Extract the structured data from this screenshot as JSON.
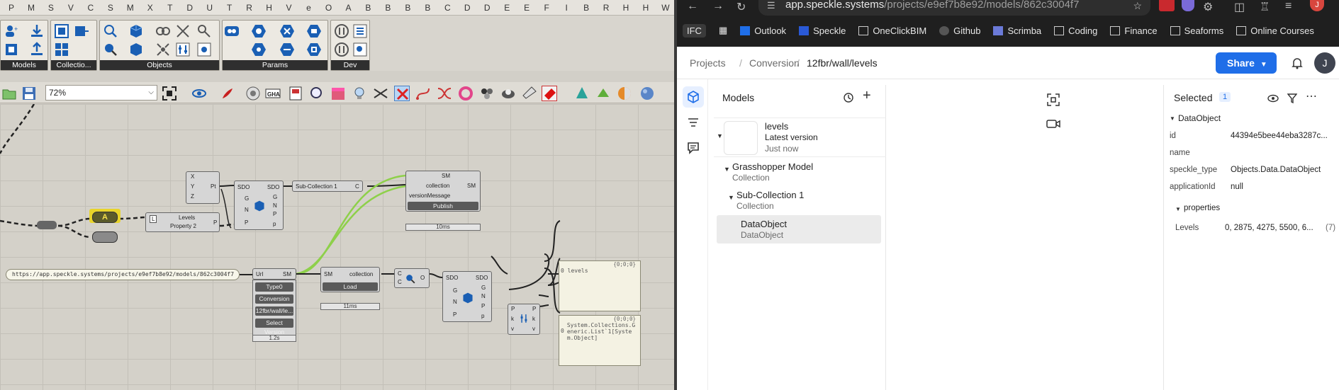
{
  "gh": {
    "column_letters": [
      "P",
      "M",
      "S",
      "V",
      "C",
      "S",
      "M",
      "X",
      "T",
      "D",
      "U",
      "T",
      "R",
      "H",
      "V",
      "e",
      "O",
      "A",
      "B",
      "B",
      "B",
      "B",
      "C",
      "D",
      "D",
      "E",
      "E",
      "F",
      "I",
      "B",
      "R",
      "H",
      "H",
      "W"
    ],
    "ribbon_groups": [
      "Models",
      "Collectio...",
      "Objects",
      "Params",
      "Dev"
    ],
    "zoom": "72%",
    "url_text": "https://app.speckle.systems/projects/e9ef7b8e92/models/862c3004f7",
    "nodes": {
      "xyz_pt": {
        "x": "X",
        "y": "Y",
        "z": "Z",
        "out": "Pt"
      },
      "sdo_create": {
        "in": [
          "SDO",
          "G",
          "N",
          "P"
        ],
        "out": [
          "SDO",
          "G",
          "N",
          "P",
          "p"
        ]
      },
      "sub_collection": {
        "label": "Sub-Collection 1",
        "out": "C"
      },
      "publish": {
        "in1": "SM",
        "in2": "collection",
        "in3": "versionMessage",
        "out": "SM",
        "button": "Publish",
        "timer": "10ms"
      },
      "levels_prop": {
        "label": "Levels",
        "sub": "Property 2",
        "out": "P",
        "l": "L"
      },
      "group_a": "A",
      "url_sm": {
        "in": "Url",
        "out": "SM",
        "buttons": [
          "Type0",
          "Conversion",
          "12fbr/wall/le...",
          "Select Version"
        ],
        "timer": "1.2s"
      },
      "load": {
        "in": "SM",
        "out": "collection",
        "button": "Load",
        "timer": "11ms"
      },
      "collection_deconstruct": {
        "in": [
          "C",
          "C"
        ],
        "out": "O"
      },
      "sdo_expand": {
        "in": [
          "SDO",
          "G",
          "N",
          "P"
        ],
        "out": [
          "SDO",
          "G",
          "N",
          "P",
          "p"
        ]
      },
      "prop_expand": {
        "in": [
          "P",
          "k",
          "v"
        ],
        "out": [
          "P",
          "k",
          "v"
        ]
      },
      "panel1": {
        "header": "{0;0;0}",
        "index": "0",
        "text": "levels"
      },
      "panel2": {
        "header": "{0;0;0}",
        "index": "0",
        "text": "System.Collections.Generic.List`1[System.Object]"
      }
    }
  },
  "browser": {
    "url_host": "app.speckle.systems",
    "url_path": "/projects/e9ef7b8e92/models/862c3004f7",
    "bookmarks": [
      "IFC",
      "Outlook",
      "Speckle",
      "OneClickBIM",
      "Github",
      "Scrimba",
      "Coding",
      "Finance",
      "Seaforms",
      "Online Courses"
    ],
    "profile_initial": "J"
  },
  "speckle": {
    "breadcrumbs": [
      "Projects",
      "Conversion",
      "12fbr/wall/levels"
    ],
    "share_label": "Share",
    "avatar_initial": "J",
    "models_title": "Models",
    "model": {
      "name": "levels",
      "version": "Latest version",
      "time": "Just now"
    },
    "tree": [
      {
        "name": "Grasshopper Model",
        "type": "Collection"
      },
      {
        "name": "Sub-Collection 1",
        "type": "Collection"
      },
      {
        "name": "DataObject",
        "type": "DataObject"
      }
    ],
    "selected": {
      "title": "Selected",
      "count": "1",
      "group": "DataObject",
      "props": [
        {
          "key": "id",
          "value": "44394e5bee44eba3287c..."
        },
        {
          "key": "name",
          "value": ""
        },
        {
          "key": "speckle_type",
          "value": "Objects.Data.DataObject"
        },
        {
          "key": "applicationId",
          "value": "null"
        }
      ],
      "sub_group": "properties",
      "levels_key": "Levels",
      "levels_value": "0, 2875, 4275, 5500, 6...",
      "levels_count": "(7)"
    }
  },
  "colors": {
    "accent": "#1f6ee8",
    "wire_green": "#8ed04a",
    "gh_canvas": "#d4d1c9"
  }
}
